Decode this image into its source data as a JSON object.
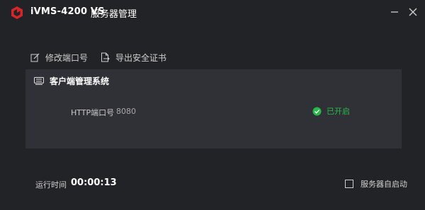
{
  "window": {
    "app_name": "iVMS-4200 VS",
    "title": "服务器管理"
  },
  "toolbar": {
    "edit_port_label": "修改端口号",
    "export_cert_label": "导出安全证书"
  },
  "panel": {
    "title": "客户端管理系统",
    "http_port_label": "HTTP端口号",
    "http_port_value": "8080",
    "status_label": "已开启"
  },
  "footer": {
    "runtime_label": "运行时间",
    "runtime_value": "00:00:13",
    "autostart_label": "服务器自启动",
    "autostart_checked": false
  },
  "colors": {
    "background": "#222326",
    "panel": "#303136",
    "logo_red": "#d7262b",
    "status_green": "#27b84a"
  },
  "icons": {
    "logo": "hikvision-logo-icon",
    "minimize": "minimize-icon",
    "close": "close-icon",
    "edit": "edit-icon",
    "export": "export-file-icon",
    "panel": "server-icon",
    "status": "check-circle-icon"
  }
}
